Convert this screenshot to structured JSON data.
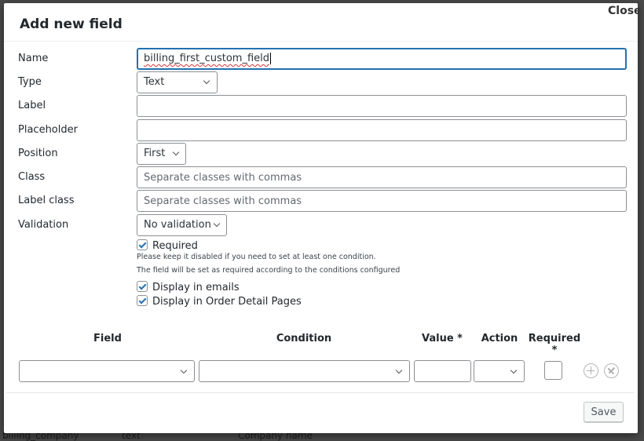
{
  "background_row": {
    "name": "billing_company",
    "type": "text",
    "label": "Company name"
  },
  "modal": {
    "title": "Add new field",
    "close_label": "Close",
    "fields": {
      "name": {
        "label": "Name",
        "value": "billing_first_custom_field"
      },
      "type": {
        "label": "Type",
        "value": "Text"
      },
      "label": {
        "label": "Label",
        "value": "",
        "placeholder": ""
      },
      "placeholder": {
        "label": "Placeholder",
        "value": "",
        "placeholder": ""
      },
      "position": {
        "label": "Position",
        "value": "First"
      },
      "class": {
        "label": "Class",
        "value": "",
        "placeholder": "Separate classes with commas"
      },
      "label_class": {
        "label": "Label class",
        "value": "",
        "placeholder": "Separate classes with commas"
      },
      "validation": {
        "label": "Validation",
        "value": "No validation"
      }
    },
    "checkboxes": {
      "required": {
        "label": "Required",
        "checked": true
      },
      "display_in_emails": {
        "label": "Display in emails",
        "checked": true
      },
      "display_in_order_detail": {
        "label": "Display in Order Detail Pages",
        "checked": true
      }
    },
    "hints": [
      "Please keep it disabled if you need to set at least one condition.",
      "The field will be set as required according to the conditions configured"
    ],
    "conditions": {
      "headers": {
        "field": "Field",
        "condition": "Condition",
        "value": "Value *",
        "action": "Action",
        "required": "Required *"
      },
      "row": {
        "field": "",
        "condition": "",
        "value": "",
        "action": "",
        "required": false
      }
    },
    "footer": {
      "save_label": "Save"
    }
  }
}
